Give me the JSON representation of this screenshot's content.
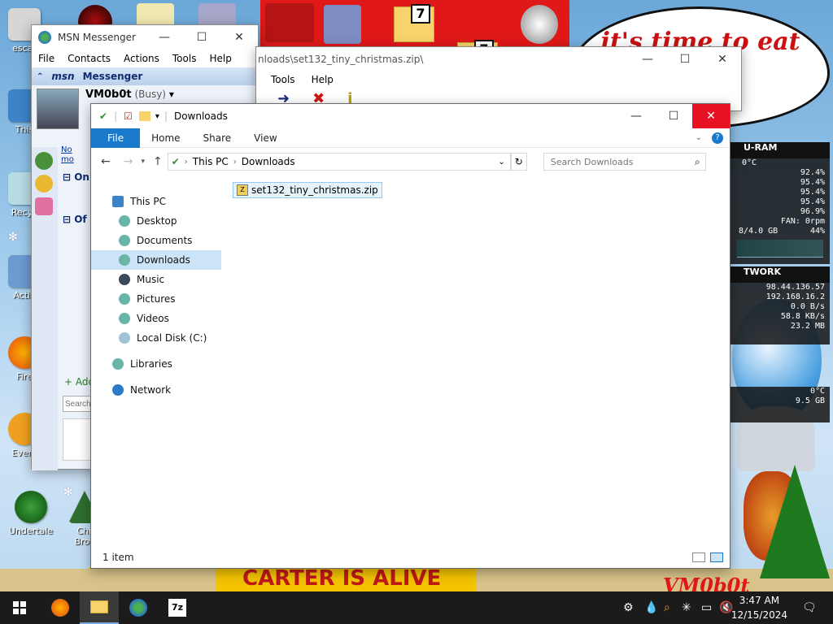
{
  "desktop": {
    "bubble_text": "it's time to eat shit\nnew",
    "banner_text": "CARTER IS ALIVE",
    "sign_text": "VM0b0t",
    "icons": [
      {
        "label": "escar"
      },
      {
        "label": "This"
      },
      {
        "label": "Recyc"
      },
      {
        "label": "Activ"
      },
      {
        "label": "Fire"
      },
      {
        "label": "Every"
      },
      {
        "label": "Undertale"
      },
      {
        "label": "Chr\nBrov"
      }
    ]
  },
  "msn": {
    "title": "MSN Messenger",
    "menu": [
      "File",
      "Contacts",
      "Actions",
      "Tools",
      "Help"
    ],
    "brand": "msn",
    "brand_sub": "Messenger",
    "username": "VM0b0t",
    "status": "(Busy)",
    "group_online": "On",
    "group_offline": "Of",
    "notice": "No\nmo",
    "add_label": "Add",
    "search_placeholder": "Search"
  },
  "zipwin": {
    "path": "nloads\\set132_tiny_christmas.zip\\",
    "menu": [
      "Tools",
      "Help"
    ]
  },
  "explorer": {
    "title": "Downloads",
    "tabs": [
      "File",
      "Home",
      "Share",
      "View"
    ],
    "breadcrumb": [
      "This PC",
      "Downloads"
    ],
    "search_placeholder": "Search Downloads",
    "nav": [
      {
        "label": "This PC",
        "indent": 0,
        "icon": "pc-icon"
      },
      {
        "label": "Desktop",
        "indent": 1,
        "icon": "desktop-icon"
      },
      {
        "label": "Documents",
        "indent": 1,
        "icon": "documents-icon"
      },
      {
        "label": "Downloads",
        "indent": 1,
        "icon": "downloads-icon"
      },
      {
        "label": "Music",
        "indent": 1,
        "icon": "music-icon"
      },
      {
        "label": "Pictures",
        "indent": 1,
        "icon": "pictures-icon"
      },
      {
        "label": "Videos",
        "indent": 1,
        "icon": "videos-icon"
      },
      {
        "label": "Local Disk (C:)",
        "indent": 1,
        "icon": "disk-icon"
      },
      {
        "label": "Libraries",
        "indent": 0,
        "icon": "libraries-icon"
      },
      {
        "label": "Network",
        "indent": 0,
        "icon": "network-icon"
      }
    ],
    "selected_nav": "Downloads",
    "files": [
      {
        "name": "set132_tiny_christmas.zip",
        "icon": "zip-file-icon"
      }
    ],
    "status": "1 item"
  },
  "gadgets": {
    "cpu_header": "U-RAM",
    "cpu_rows": [
      "0°C",
      "92.4%",
      "95.4%",
      "95.4%",
      "95.4%",
      "96.9%",
      "FAN: 0rpm"
    ],
    "ram": "8/4.0 GB",
    "ram_pct": "44%",
    "net_header": "TWORK",
    "net_rows": [
      "98.44.136.57",
      "192.168.16.2",
      "0.0 B/s",
      "58.8 KB/s",
      "23.2 MB"
    ],
    "temp_rows": [
      "0°C",
      "9.5 GB"
    ]
  },
  "taskbar": {
    "time": "3:47 AM",
    "date": "12/15/2024",
    "apps": [
      "firefox-icon",
      "file-explorer-icon",
      "msn-icon",
      "7zip-icon"
    ],
    "seven_zip_label": "7z"
  },
  "colors": {
    "accent": "#1979ca",
    "close_red": "#e81123",
    "selection": "#cce4f7"
  }
}
